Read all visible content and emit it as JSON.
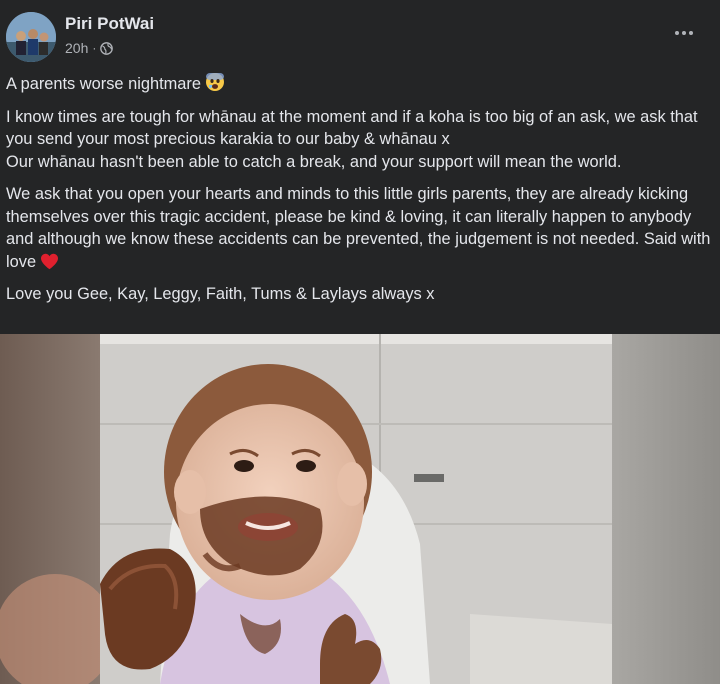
{
  "post": {
    "author": "Piri PotWai",
    "time": "20h",
    "separator": "·",
    "privacy_icon": "globe-icon",
    "more_icon": "more-options-icon",
    "paragraphs": [
      "A parents worse nightmare",
      "I know times are tough for whānau at the moment and if a koha is too big of an ask, we ask that you send your most precious karakia to our baby & whānau x",
      "Our whānau hasn't been able to catch a break, and your support will mean the world.",
      "We ask that you open your hearts and minds to this little girls parents, they are already kicking themselves over this tragic accident, please be kind & loving, it can literally happen to anybody and although we know these accidents can be prevented, the judgement is not needed. Said with love",
      "Love you Gee, Kay, Leggy, Faith, Tums & Laylays always x"
    ],
    "emojis": {
      "first_paragraph": "fearful-face-icon",
      "fourth_paragraph": "red-heart-icon"
    },
    "photo_icon": "photo-baby-icon"
  },
  "colors": {
    "background": "#242526",
    "text": "#e4e6eb",
    "muted": "#b0b3b8",
    "heart": "#e0202e"
  }
}
